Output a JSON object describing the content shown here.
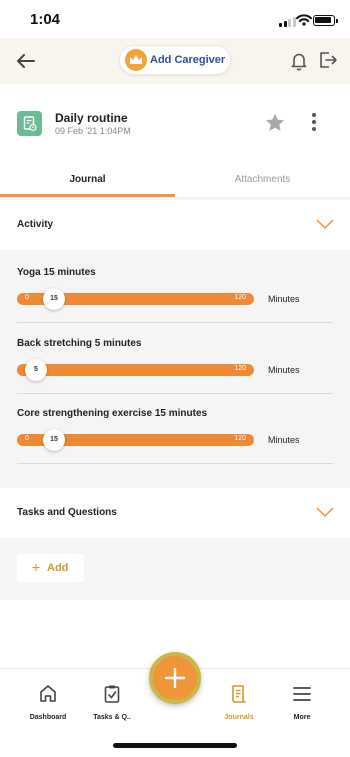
{
  "status_bar": {
    "time": "1:04"
  },
  "header": {
    "add_caregiver_label": "Add Caregiver"
  },
  "entry": {
    "title": "Daily routine",
    "date": "09 Feb '21 1:04PM"
  },
  "tabs": [
    {
      "label": "Journal",
      "active": true
    },
    {
      "label": "Attachments",
      "active": false
    }
  ],
  "sections": {
    "activity": {
      "label": "Activity"
    },
    "tasks": {
      "label": "Tasks and Questions"
    }
  },
  "activities": [
    {
      "name": "Yoga 15 minutes",
      "min": "0",
      "max": "120",
      "value": 15,
      "value_label": "15",
      "unit": "Minutes"
    },
    {
      "name": "Back stretching 5 minutes",
      "min": "0",
      "max": "120",
      "value": 5,
      "value_label": "5",
      "unit": "Minutes"
    },
    {
      "name": "Core strengthening exercise 15 minutes",
      "min": "0",
      "max": "120",
      "value": 15,
      "value_label": "15",
      "unit": "Minutes"
    }
  ],
  "add_button": {
    "label": "Add"
  },
  "bottom_nav": [
    {
      "label": "Dashboard",
      "icon": "home-icon"
    },
    {
      "label": "Tasks & Q..",
      "icon": "clipboard-icon"
    },
    {
      "label": "Journals",
      "icon": "journal-icon",
      "active": true
    },
    {
      "label": "More",
      "icon": "menu-icon"
    }
  ],
  "colors": {
    "accent": "#f0963a",
    "gold": "#d49a2a",
    "entry_icon": "#6dbb95",
    "link_blue": "#2c4e9a"
  }
}
